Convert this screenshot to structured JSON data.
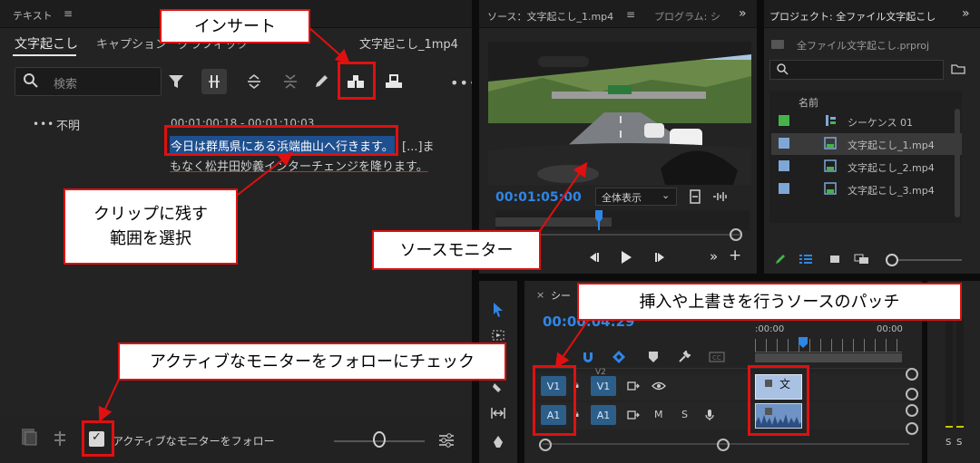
{
  "left_panel": {
    "header_title": "テキスト",
    "tabs": [
      "文字起こし",
      "キャプション",
      "グラフィック"
    ],
    "clip_name": "文字起こし_1mp4",
    "search_placeholder": "検索",
    "speaker": "不明",
    "timecode": "00:01:00:18 - 00:01:10:03",
    "line1_selected": "今日は群馬県にある浜端曲山へ行きます。",
    "line1_rest": "[...]ま",
    "line2": "もなく松井田妙義インターチェンジを降ります。",
    "follow_label": "アクティブなモニターをフォロー"
  },
  "source_panel": {
    "tab_source": "ソース：文字起こし_1.mp4",
    "tab_program": "プログラム: シ",
    "timecode": "00:01:05:00",
    "zoom_select": "全体表示"
  },
  "project_panel": {
    "title": "プロジェクト: 全ファイル文字起こし",
    "project_file": "全ファイル文字起こし.prproj",
    "column_name": "名前",
    "items": [
      {
        "name": "シーケンス 01",
        "color": "#45b34a"
      },
      {
        "name": "文字起こし_1.mp4",
        "color": "#7fa7d6"
      },
      {
        "name": "文字起こし_2.mp4",
        "color": "#7fa7d6"
      },
      {
        "name": "文字起こし_3.mp4",
        "color": "#7fa7d6"
      }
    ]
  },
  "timeline": {
    "tab_label": "シー",
    "timecode": "00:00:04:29",
    "ruler_labels": [
      ":00:00",
      "00:00"
    ],
    "tracks": {
      "source_v1": "V1",
      "source_a1": "A1",
      "target_v1": "V1",
      "target_a1": "A1",
      "v2": "V2",
      "mute": "M",
      "solo": "S"
    },
    "clip_label": "文"
  },
  "meters": {
    "labels": [
      "S",
      "S"
    ]
  },
  "callouts": {
    "insert": "インサート",
    "select_range": "クリップに残す\n範囲を選択",
    "source_monitor": "ソースモニター",
    "patch": "挿入や上書きを行うソースのパッチ",
    "follow": "アクティブなモニターをフォローにチェック"
  },
  "colors": {
    "accent_blue": "#2f86e6",
    "callout_red": "#e01010",
    "selection_blue": "#1e4f8f"
  }
}
